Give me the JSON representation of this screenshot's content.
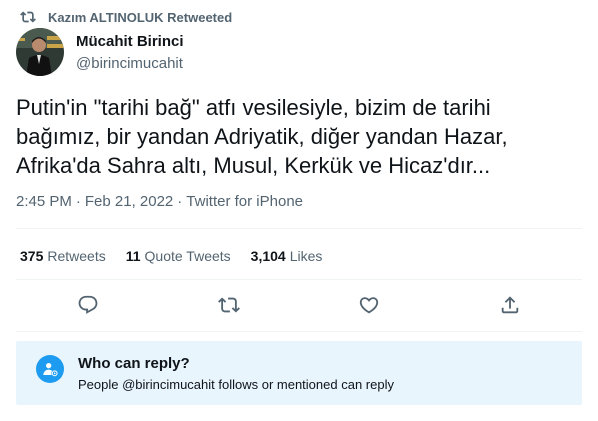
{
  "retweet_header": {
    "icon": "retweet-icon",
    "text": "Kazım ALTINOLUK Retweeted"
  },
  "author": {
    "name": "Mücahit Birinci",
    "handle": "@birincimucahit"
  },
  "tweet": {
    "text": "Putin'in \"tarihi bağ\" atfı vesilesiyle, bizim de tarihi\nbağımız, bir yandan Adriyatik, diğer yandan Hazar,\nAfrika'da Sahra altı, Musul, Kerkük ve Hicaz'dır..."
  },
  "meta": {
    "time": "2:45 PM",
    "separator": "·",
    "date": "Feb 21, 2022",
    "source": "Twitter for iPhone"
  },
  "stats": {
    "retweets_count": "375",
    "retweets_label": "Retweets",
    "quotes_count": "11",
    "quotes_label": "Quote Tweets",
    "likes_count": "3,104",
    "likes_label": "Likes"
  },
  "actions": [
    "reply-icon",
    "retweet-icon",
    "like-icon",
    "share-icon"
  ],
  "reply_settings": {
    "icon": "mention-user-icon",
    "title": "Who can reply?",
    "description": "People @birincimucahit follows or mentioned can reply"
  },
  "colors": {
    "text": "#0f1419",
    "secondary": "#536471",
    "accent": "#1d9bf0",
    "reply_box_bg": "#e8f5fd",
    "divider": "#eff3f4"
  }
}
